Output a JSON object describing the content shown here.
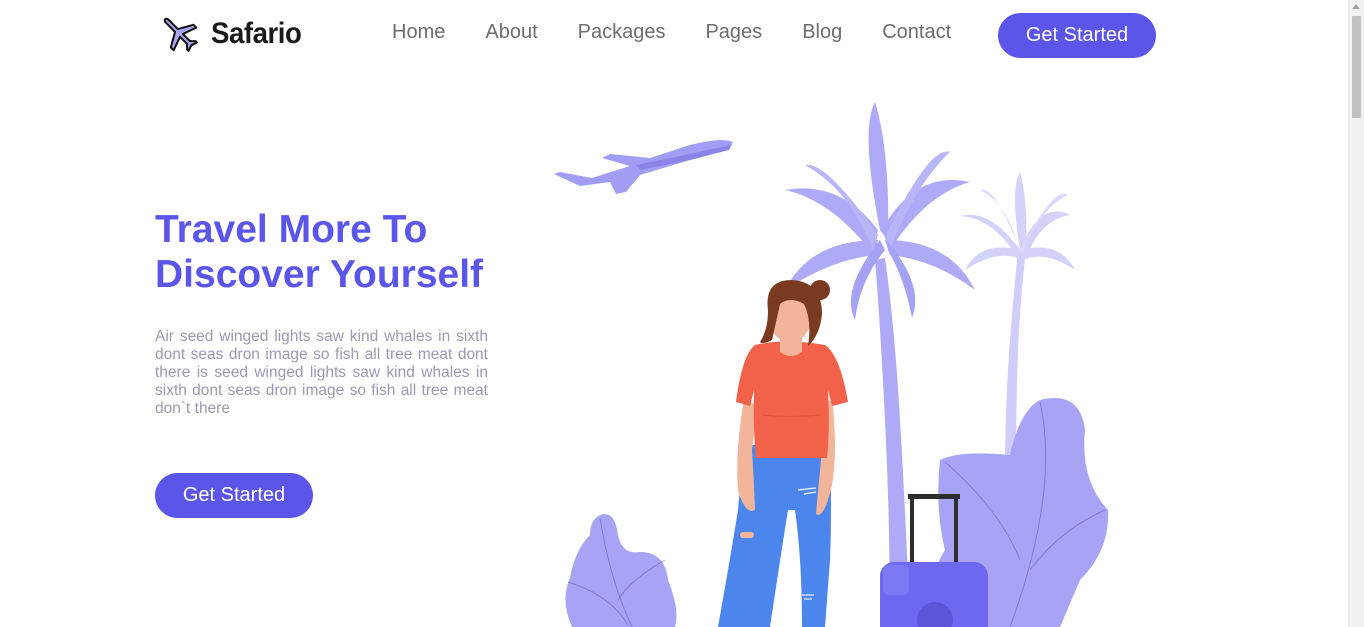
{
  "header": {
    "brand": "Safario",
    "nav": [
      {
        "label": "Home"
      },
      {
        "label": "About"
      },
      {
        "label": "Packages"
      },
      {
        "label": "Pages"
      },
      {
        "label": "Blog"
      },
      {
        "label": "Contact"
      }
    ],
    "cta_label": "Get Started"
  },
  "hero": {
    "title_line1": "Travel More To",
    "title_line2": "Discover Yourself",
    "text": "Air seed winged lights saw kind whales in sixth dont seas dron image so fish all tree meat dont there is seed winged lights saw kind whales in sixth dont seas dron image so fish all tree meat don`t there",
    "cta_label": "Get Started"
  },
  "colors": {
    "accent": "#5c55ea",
    "illustration_light": "#aeaaf7",
    "illustration_lighter": "#cfcdfb",
    "shirt": "#f2624a",
    "jeans": "#4c86ec"
  },
  "icons": {
    "logo": "airplane-icon"
  }
}
